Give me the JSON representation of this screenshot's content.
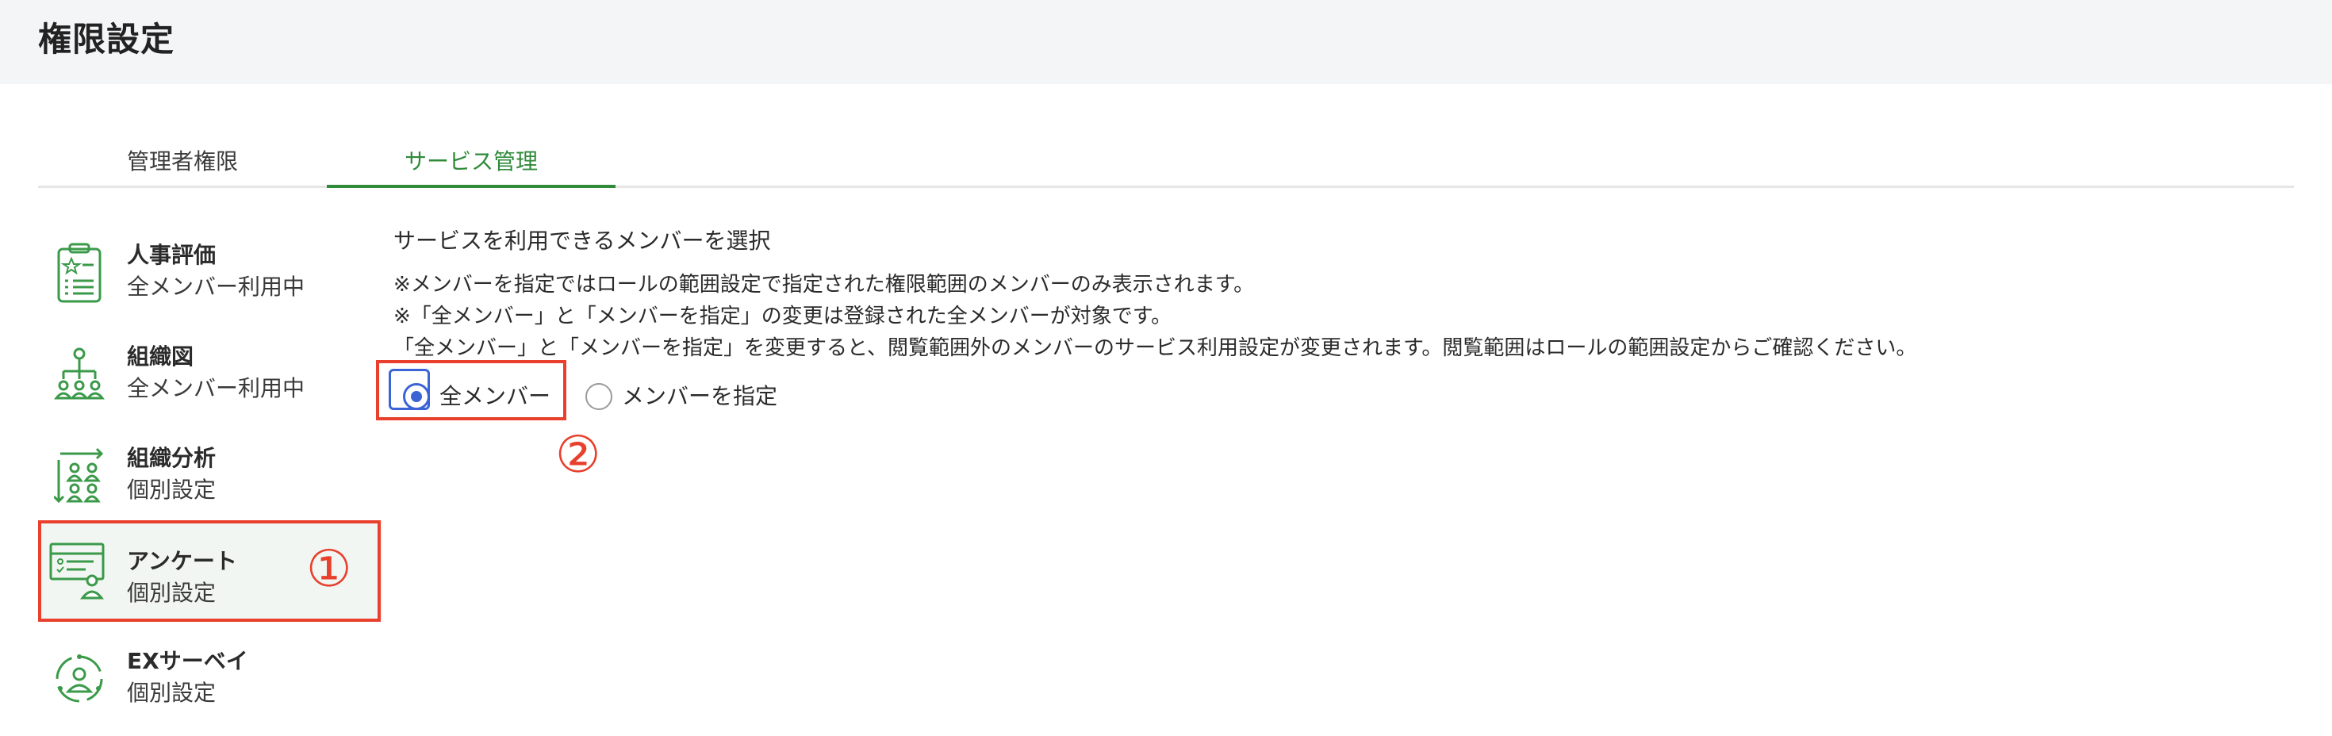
{
  "page": {
    "title": "権限設定"
  },
  "tabs": [
    {
      "label": "管理者権限",
      "active": false
    },
    {
      "label": "サービス管理",
      "active": true
    }
  ],
  "colors": {
    "accent_green": "#2f8a3a",
    "annotation_red": "#e8402d",
    "radio_blue": "#3b64d6"
  },
  "sidebar": {
    "items": [
      {
        "name": "人事評価",
        "status": "全メンバー利用中",
        "icon": "evaluation-clipboard-icon"
      },
      {
        "name": "組織図",
        "status": "全メンバー利用中",
        "icon": "org-chart-icon"
      },
      {
        "name": "組織分析",
        "status": "個別設定",
        "icon": "org-analysis-icon"
      },
      {
        "name": "アンケート",
        "status": "個別設定",
        "icon": "survey-icon",
        "selected": true
      },
      {
        "name": "EXサーベイ",
        "status": "個別設定",
        "icon": "ex-survey-icon"
      }
    ]
  },
  "annotations": {
    "step1": "①",
    "step2": "②"
  },
  "content": {
    "title": "サービスを利用できるメンバーを選択",
    "notes": [
      "※メンバーを指定ではロールの範囲設定で指定された権限範囲のメンバーのみ表示されます。",
      "※「全メンバー」と「メンバーを指定」の変更は登録された全メンバーが対象です。",
      "「全メンバー」と「メンバーを指定」を変更すると、閲覧範囲外のメンバーのサービス利用設定が変更されます。閲覧範囲はロールの範囲設定からご確認ください。"
    ],
    "radio_options": [
      {
        "label": "全メンバー",
        "checked": true
      },
      {
        "label": "メンバーを指定",
        "checked": false
      }
    ]
  }
}
